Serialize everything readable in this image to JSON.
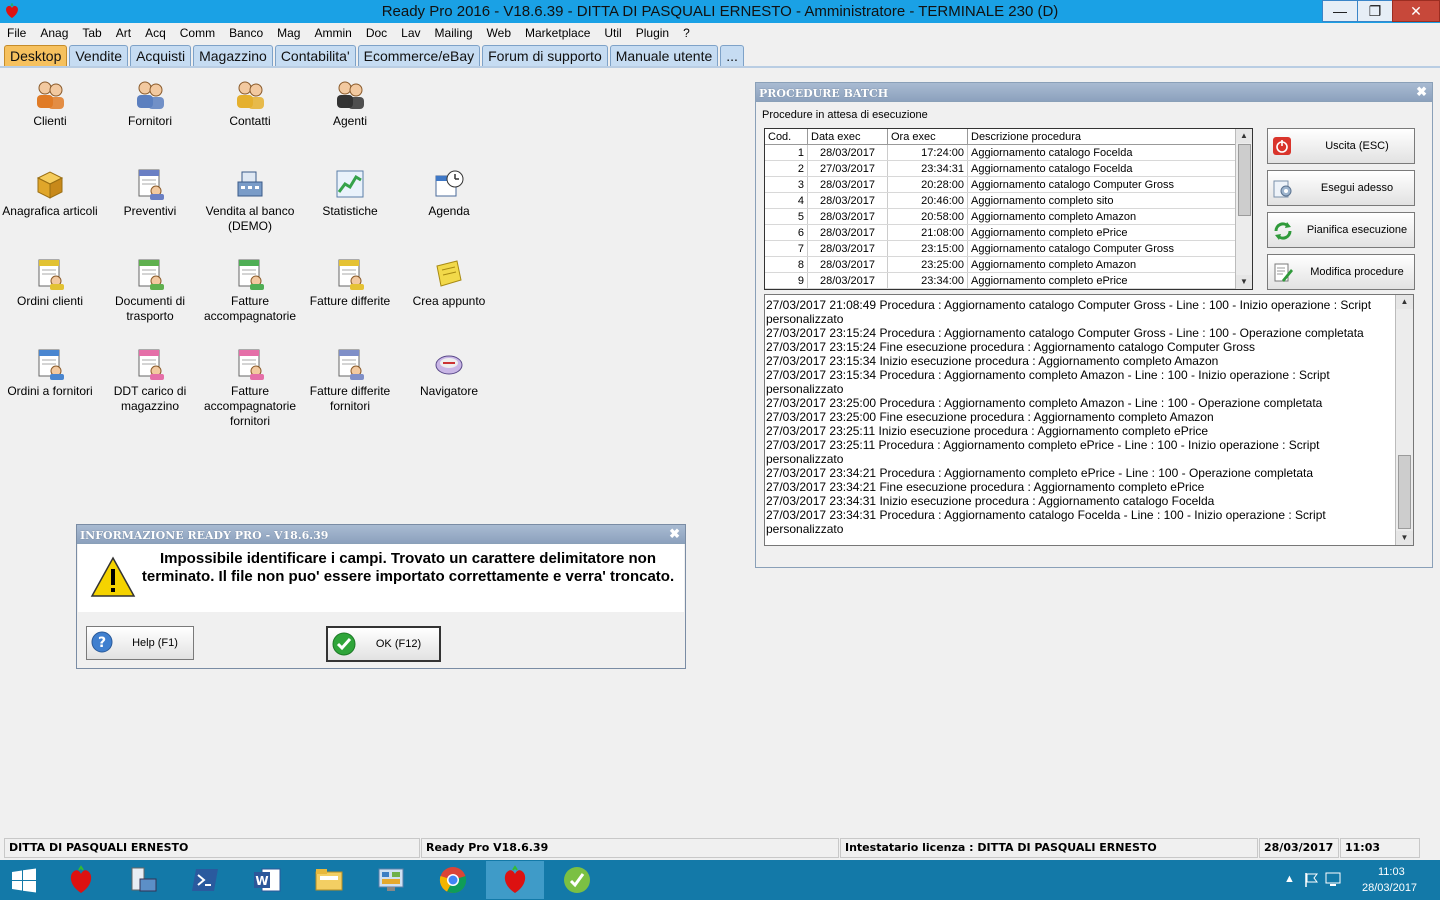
{
  "window": {
    "title": "Ready Pro 2016 - V18.6.39 - DITTA DI PASQUALI ERNESTO - Amministratore - TERMINALE 230 (D)"
  },
  "menu": [
    "File",
    "Anag",
    "Tab",
    "Art",
    "Acq",
    "Comm",
    "Banco",
    "Mag",
    "Ammin",
    "Doc",
    "Lav",
    "Mailing",
    "Web",
    "Marketplace",
    "Util",
    "Plugin",
    "?"
  ],
  "tabs": [
    "Desktop",
    "Vendite",
    "Acquisti",
    "Magazzino",
    "Contabilita'",
    "Ecommerce/eBay",
    "Forum di supporto",
    "Manuale utente",
    "..."
  ],
  "desktop_icons": [
    {
      "label": "Clienti",
      "icon": "clients-icon"
    },
    {
      "label": "Fornitori",
      "icon": "suppliers-icon"
    },
    {
      "label": "Contatti",
      "icon": "contacts-icon"
    },
    {
      "label": "Agenti",
      "icon": "agent-icon"
    },
    {
      "label": "Anagrafica articoli",
      "icon": "articles-box-icon"
    },
    {
      "label": "Preventivi",
      "icon": "quotes-icon"
    },
    {
      "label": "Vendita al banco (DEMO)",
      "icon": "cash-register-icon"
    },
    {
      "label": "Statistiche",
      "icon": "statistics-icon"
    },
    {
      "label": "Agenda",
      "icon": "agenda-icon"
    },
    {
      "label": "Ordini clienti",
      "icon": "customer-orders-icon"
    },
    {
      "label": "Documenti di trasporto",
      "icon": "transport-docs-icon"
    },
    {
      "label": "Fatture accompagnatorie",
      "icon": "invoices-icon"
    },
    {
      "label": "Fatture differite",
      "icon": "deferred-invoices-icon"
    },
    {
      "label": "Crea appunto",
      "icon": "note-icon"
    },
    {
      "label": "Ordini a fornitori",
      "icon": "supplier-orders-icon"
    },
    {
      "label": "DDT carico di magazzino",
      "icon": "warehouse-ddt-icon"
    },
    {
      "label": "Fatture accompagnatorie fornitori",
      "icon": "supplier-invoices-icon"
    },
    {
      "label": "Fatture differite fornitori",
      "icon": "supplier-deferred-icon"
    },
    {
      "label": "Navigatore",
      "icon": "navigator-icon"
    }
  ],
  "batch": {
    "title": "PROCEDURE BATCH",
    "subtitle": "Procedure in attesa di esecuzione",
    "columns": [
      "Cod.",
      "Data exec",
      "Ora exec",
      "Descrizione procedura"
    ],
    "rows": [
      [
        "1",
        "28/03/2017",
        "17:24:00",
        "Aggiornamento catalogo Focelda"
      ],
      [
        "2",
        "27/03/2017",
        "23:34:31",
        "Aggiornamento catalogo Focelda"
      ],
      [
        "3",
        "28/03/2017",
        "20:28:00",
        "Aggiornamento catalogo Computer Gross"
      ],
      [
        "4",
        "28/03/2017",
        "20:46:00",
        "Aggiornamento completo sito"
      ],
      [
        "5",
        "28/03/2017",
        "20:58:00",
        "Aggiornamento completo Amazon"
      ],
      [
        "6",
        "28/03/2017",
        "21:08:00",
        "Aggiornamento completo ePrice"
      ],
      [
        "7",
        "28/03/2017",
        "23:15:00",
        "Aggiornamento catalogo Computer Gross"
      ],
      [
        "8",
        "28/03/2017",
        "23:25:00",
        "Aggiornamento completo Amazon"
      ],
      [
        "9",
        "28/03/2017",
        "23:34:00",
        "Aggiornamento completo ePrice"
      ]
    ],
    "buttons": [
      "Uscita (ESC)",
      "Esegui adesso",
      "Pianifica esecuzione",
      "Modifica procedure"
    ],
    "log": [
      "27/03/2017 21:08:49 Procedura : Aggiornamento catalogo Computer Gross - Line : 100 - Inizio operazione : Script personalizzato",
      "27/03/2017 23:15:24 Procedura : Aggiornamento catalogo Computer Gross - Line : 100 - Operazione completata",
      "27/03/2017 23:15:24 Fine esecuzione procedura : Aggiornamento catalogo Computer Gross",
      "27/03/2017 23:15:34 Inizio esecuzione procedura : Aggiornamento completo Amazon",
      "27/03/2017 23:15:34 Procedura : Aggiornamento completo Amazon - Line : 100 - Inizio operazione : Script personalizzato",
      "27/03/2017 23:25:00 Procedura : Aggiornamento completo Amazon - Line : 100 - Operazione completata",
      "27/03/2017 23:25:00 Fine esecuzione procedura : Aggiornamento completo Amazon",
      "27/03/2017 23:25:11 Inizio esecuzione procedura : Aggiornamento completo ePrice",
      "27/03/2017 23:25:11 Procedura : Aggiornamento completo ePrice - Line : 100 - Inizio operazione : Script personalizzato",
      "27/03/2017 23:34:21 Procedura : Aggiornamento completo ePrice - Line : 100 - Operazione completata",
      "27/03/2017 23:34:21 Fine esecuzione procedura : Aggiornamento completo ePrice",
      "27/03/2017 23:34:31 Inizio esecuzione procedura : Aggiornamento catalogo Focelda",
      "27/03/2017 23:34:31 Procedura : Aggiornamento catalogo Focelda - Line : 100 - Inizio operazione : Script personalizzato"
    ]
  },
  "dialog": {
    "title": "INFORMAZIONE READY PRO - V18.6.39",
    "message": "Impossibile identificare i campi. Trovato un carattere delimitatore non terminato. Il file non puo' essere importato correttamente e verra' troncato.",
    "help_label": "Help (F1)",
    "ok_label": "OK (F12)"
  },
  "status": {
    "company": "DITTA DI PASQUALI ERNESTO",
    "version": "Ready Pro V18.6.39",
    "license": "Intestatario licenza : DITTA DI PASQUALI ERNESTO",
    "date": "28/03/2017",
    "time": "11:03"
  },
  "taskbar": {
    "clock_time": "11:03",
    "clock_date": "28/03/2017",
    "apps": [
      "start-icon",
      "ready-pro-icon",
      "network-admin-icon",
      "powershell-icon",
      "word-icon",
      "explorer-icon",
      "control-panel-icon",
      "chrome-icon",
      "ready-pro-active-icon",
      "teamviewer-icon"
    ]
  },
  "colors": {
    "titlebar": "#1aa1e5",
    "active_tab": "#f6c15e",
    "tab": "#c6dcf2",
    "taskbar": "#1379a8"
  }
}
